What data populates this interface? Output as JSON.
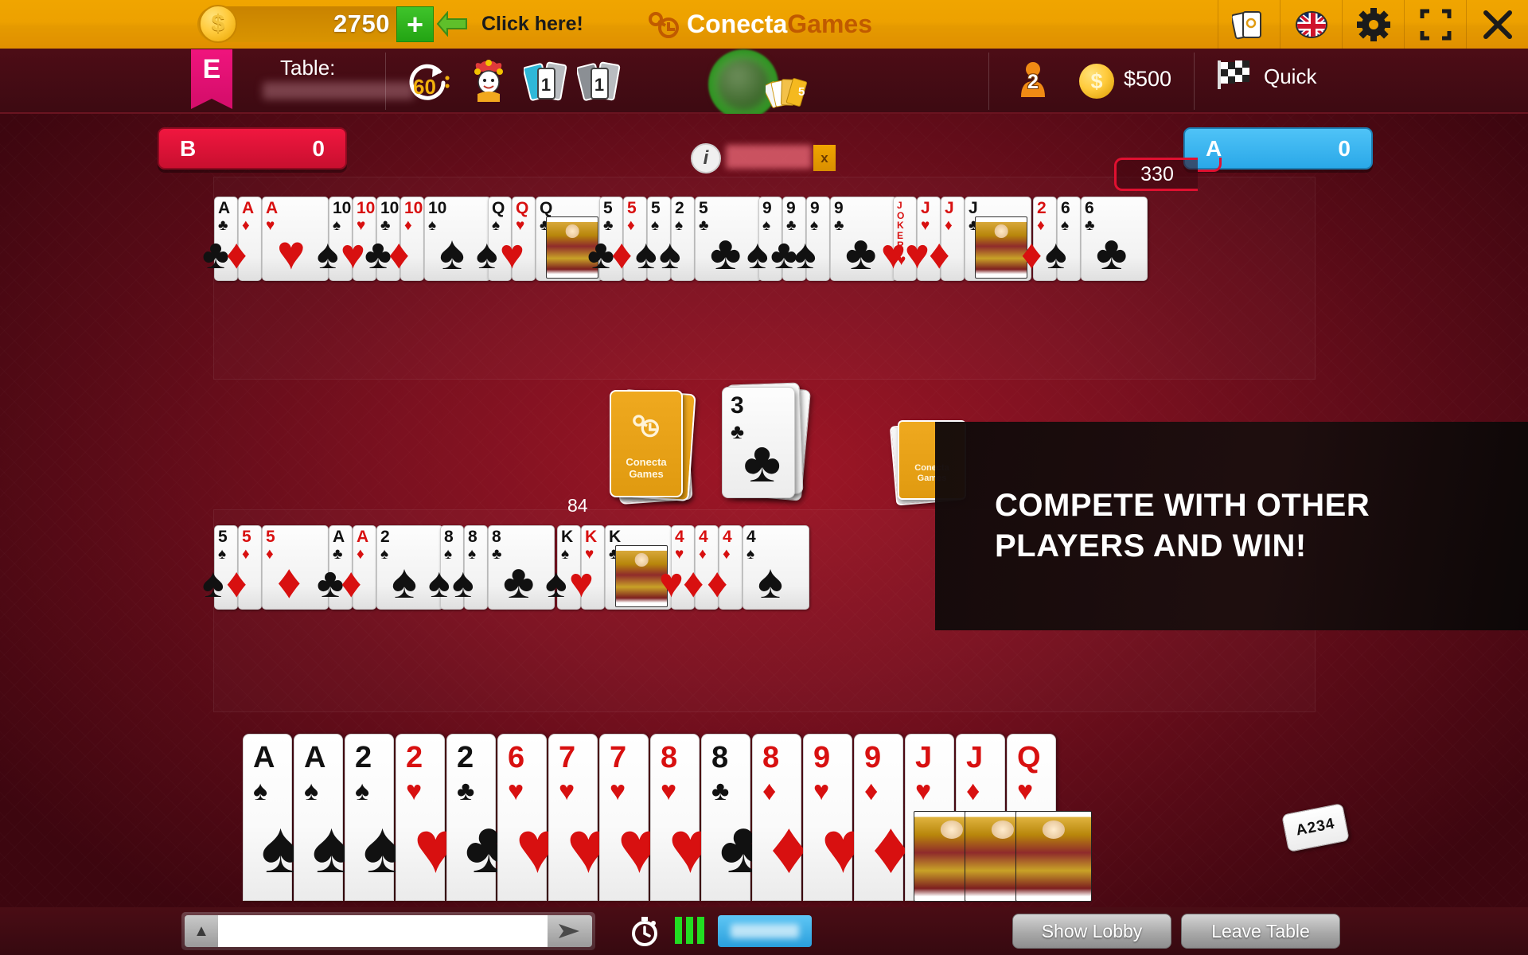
{
  "topbar": {
    "coin_icon": "dollar-coin-icon",
    "coin_amount": "2750",
    "plus_label": "+",
    "arrow_icon": "arrow-left-icon",
    "click_here": "Click here!",
    "brand_part1": "Conecta",
    "brand_part2": "Games",
    "icons": [
      {
        "name": "cards-icon",
        "glyph": "cards"
      },
      {
        "name": "uk-flag-icon",
        "glyph": "flag"
      },
      {
        "name": "gear-icon",
        "glyph": "gear"
      },
      {
        "name": "fullscreen-icon",
        "glyph": "fullscreen"
      },
      {
        "name": "close-icon",
        "glyph": "close"
      }
    ]
  },
  "subbar": {
    "flag_letter": "E",
    "table_label": "Table:",
    "table_name": "",
    "timer_seconds": "60",
    "joker_icon": "joker-icon",
    "wild_blue_count": "1",
    "wild_gray_count": "1",
    "players_count": "2",
    "money_amount": "$500",
    "quick_label": "Quick",
    "quick_icon": "checkered-flag-icon"
  },
  "scoreboard": {
    "team_b_label": "B",
    "team_b_score": "0",
    "team_a_label": "A",
    "team_a_score": "0",
    "round_points": "330"
  },
  "player_strip": {
    "info_icon": "i",
    "player_name": "",
    "close_label": "x"
  },
  "center": {
    "deck_back_line1": "Conecta",
    "deck_back_line2": "Games",
    "deck_count": "84",
    "discard_rank": "3",
    "discard_suit": "♣",
    "discard_color": "black"
  },
  "ad": {
    "line1": "COMPETE WITH OTHER",
    "line2": "PLAYERS AND WIN!"
  },
  "melds_top": [
    {
      "cards": [
        {
          "rank": "A",
          "suit": "♣",
          "color": "black"
        },
        {
          "rank": "A",
          "suit": "♦",
          "color": "red"
        },
        {
          "rank": "A",
          "suit": "♥",
          "color": "red"
        }
      ]
    },
    {
      "cards": [
        {
          "rank": "10",
          "suit": "♠",
          "color": "black"
        },
        {
          "rank": "10",
          "suit": "♥",
          "color": "red"
        },
        {
          "rank": "10",
          "suit": "♣",
          "color": "black"
        },
        {
          "rank": "10",
          "suit": "♦",
          "color": "red"
        },
        {
          "rank": "10",
          "suit": "♠",
          "color": "black"
        }
      ]
    },
    {
      "cards": [
        {
          "rank": "Q",
          "suit": "♠",
          "color": "black"
        },
        {
          "rank": "Q",
          "suit": "♥",
          "color": "red"
        },
        {
          "rank": "Q",
          "suit": "♣",
          "color": "black",
          "face": true
        }
      ]
    },
    {
      "cards": [
        {
          "rank": "5",
          "suit": "♣",
          "color": "black"
        },
        {
          "rank": "5",
          "suit": "♦",
          "color": "red"
        },
        {
          "rank": "5",
          "suit": "♠",
          "color": "black"
        },
        {
          "rank": "2",
          "suit": "♠",
          "color": "black"
        },
        {
          "rank": "5",
          "suit": "♣",
          "color": "black"
        }
      ]
    },
    {
      "cards": [
        {
          "rank": "9",
          "suit": "♠",
          "color": "black"
        },
        {
          "rank": "9",
          "suit": "♣",
          "color": "black"
        },
        {
          "rank": "9",
          "suit": "♠",
          "color": "black"
        },
        {
          "rank": "9",
          "suit": "♣",
          "color": "black"
        }
      ]
    },
    {
      "cards": [
        {
          "rank": "JOKER",
          "suit": "♥",
          "color": "red",
          "joker": true
        },
        {
          "rank": "J",
          "suit": "♥",
          "color": "red"
        },
        {
          "rank": "J",
          "suit": "♦",
          "color": "red"
        },
        {
          "rank": "J",
          "suit": "♣",
          "color": "black",
          "face": true
        }
      ]
    },
    {
      "cards": [
        {
          "rank": "2",
          "suit": "♦",
          "color": "red"
        },
        {
          "rank": "6",
          "suit": "♠",
          "color": "black"
        },
        {
          "rank": "6",
          "suit": "♣",
          "color": "black"
        }
      ]
    }
  ],
  "melds_bottom": [
    {
      "cards": [
        {
          "rank": "5",
          "suit": "♠",
          "color": "black"
        },
        {
          "rank": "5",
          "suit": "♦",
          "color": "red"
        },
        {
          "rank": "5",
          "suit": "♦",
          "color": "red"
        }
      ]
    },
    {
      "cards": [
        {
          "rank": "A",
          "suit": "♣",
          "color": "black"
        },
        {
          "rank": "A",
          "suit": "♦",
          "color": "red"
        },
        {
          "rank": "2",
          "suit": "♠",
          "color": "black"
        }
      ]
    },
    {
      "cards": [
        {
          "rank": "8",
          "suit": "♠",
          "color": "black"
        },
        {
          "rank": "8",
          "suit": "♠",
          "color": "black"
        },
        {
          "rank": "8",
          "suit": "♣",
          "color": "black"
        }
      ]
    },
    {
      "cards": [
        {
          "rank": "K",
          "suit": "♠",
          "color": "black"
        },
        {
          "rank": "K",
          "suit": "♥",
          "color": "red"
        },
        {
          "rank": "K",
          "suit": "♣",
          "color": "black",
          "face": true
        }
      ]
    },
    {
      "cards": [
        {
          "rank": "4",
          "suit": "♥",
          "color": "red"
        },
        {
          "rank": "4",
          "suit": "♦",
          "color": "red"
        },
        {
          "rank": "4",
          "suit": "♦",
          "color": "red"
        },
        {
          "rank": "4",
          "suit": "♠",
          "color": "black"
        }
      ]
    }
  ],
  "hand": [
    {
      "rank": "A",
      "suit": "♠",
      "color": "black"
    },
    {
      "rank": "A",
      "suit": "♠",
      "color": "black"
    },
    {
      "rank": "2",
      "suit": "♠",
      "color": "black"
    },
    {
      "rank": "2",
      "suit": "♥",
      "color": "red"
    },
    {
      "rank": "2",
      "suit": "♣",
      "color": "black"
    },
    {
      "rank": "6",
      "suit": "♥",
      "color": "red"
    },
    {
      "rank": "7",
      "suit": "♥",
      "color": "red"
    },
    {
      "rank": "7",
      "suit": "♥",
      "color": "red"
    },
    {
      "rank": "8",
      "suit": "♥",
      "color": "red"
    },
    {
      "rank": "8",
      "suit": "♣",
      "color": "black"
    },
    {
      "rank": "8",
      "suit": "♦",
      "color": "red"
    },
    {
      "rank": "9",
      "suit": "♥",
      "color": "red"
    },
    {
      "rank": "9",
      "suit": "♦",
      "color": "red"
    },
    {
      "rank": "J",
      "suit": "♥",
      "color": "red",
      "face": true
    },
    {
      "rank": "J",
      "suit": "♦",
      "color": "red",
      "face": true
    },
    {
      "rank": "Q",
      "suit": "♥",
      "color": "red",
      "face": true
    }
  ],
  "sort_chip": "A234",
  "bottombar": {
    "chat_value": "",
    "chat_placeholder": "",
    "send_icon": "send-arrow-icon",
    "collapse_icon": "chevron-up-icon",
    "timer_icon": "stopwatch-icon",
    "signal_icon": "signal-bars-icon",
    "show_lobby": "Show Lobby",
    "leave_table": "Leave Table"
  },
  "colors": {
    "gold": "#eda100",
    "team_b": "#e01339",
    "team_a": "#3fb5ea",
    "felt": "#8c1422",
    "green": "#22dd22"
  }
}
